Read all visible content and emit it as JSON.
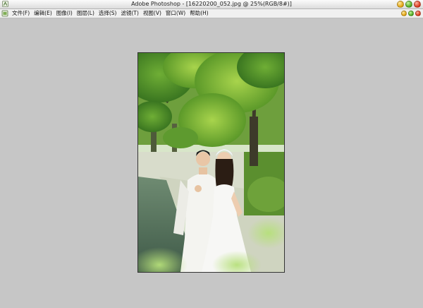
{
  "window": {
    "title": "Adobe Photoshop - [16220200_052.jpg @ 25%(RGB/8#)]",
    "controls": [
      "minimize",
      "maximize",
      "close"
    ]
  },
  "menubar": {
    "items": [
      {
        "label": "文件(F)"
      },
      {
        "label": "编辑(E)"
      },
      {
        "label": "图像(I)"
      },
      {
        "label": "图层(L)"
      },
      {
        "label": "选择(S)"
      },
      {
        "label": "滤镜(T)"
      },
      {
        "label": "视图(V)"
      },
      {
        "label": "窗口(W)"
      },
      {
        "label": "帮助(H)"
      }
    ]
  },
  "document": {
    "filename": "16220200_052.jpg",
    "zoom": "25%",
    "mode": "RGB/8#",
    "image_description": "wedding couple in white under green trees beside water"
  },
  "colors": {
    "workspace_bg": "#c6c6c6",
    "titlebar_bg": "#f2f2f2",
    "menubar_bg": "#f0f0f0"
  }
}
